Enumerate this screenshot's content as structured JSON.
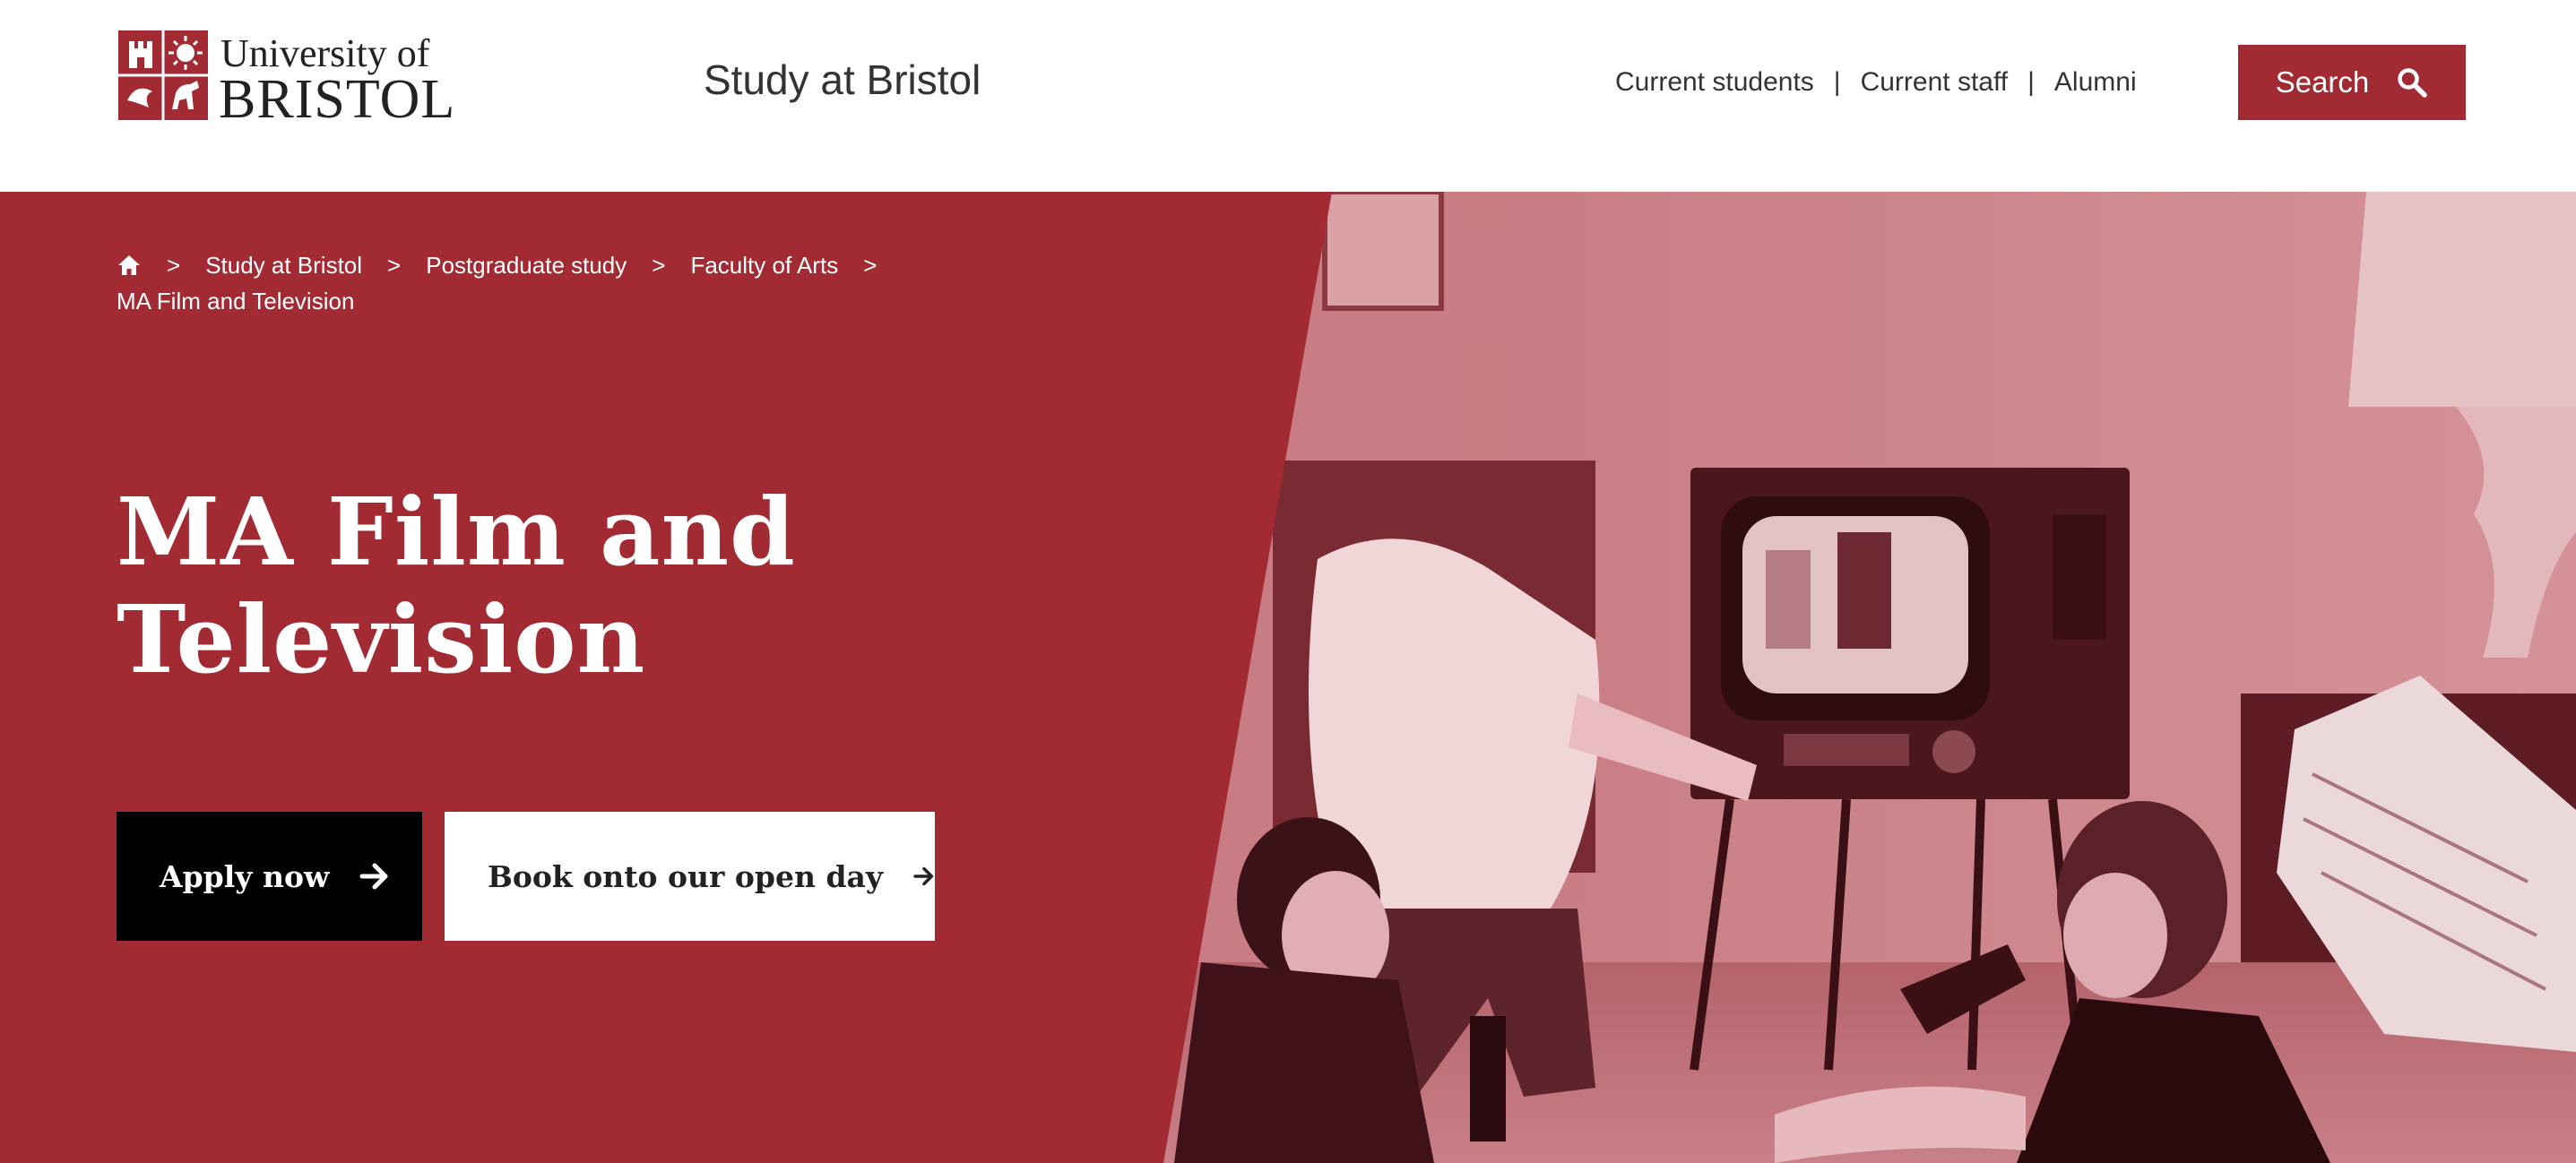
{
  "brand": {
    "logo_line1": "University of",
    "logo_line2": "BRISTOL",
    "primary_color": "#a22a33"
  },
  "header": {
    "site_title": "Study at Bristol",
    "utility_nav": [
      {
        "label": "Current students"
      },
      {
        "label": "Current staff"
      },
      {
        "label": "Alumni"
      }
    ],
    "separator": "|",
    "search_label": "Search"
  },
  "breadcrumb": {
    "separator": ">",
    "items": [
      {
        "label": "Study at Bristol"
      },
      {
        "label": "Postgraduate study"
      },
      {
        "label": "Faculty of Arts"
      },
      {
        "label": "MA Film and Television"
      }
    ]
  },
  "hero": {
    "title_line1": "MA Film and",
    "title_line2": "Television",
    "apply_label": "Apply now",
    "openday_label": "Book onto our open day"
  },
  "icons": {
    "home": "home-icon",
    "search": "search-icon",
    "arrow": "arrow-right-icon"
  }
}
